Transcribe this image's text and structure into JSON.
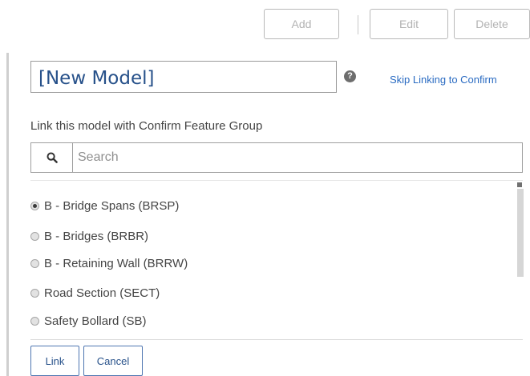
{
  "toolbar": {
    "add_label": "Add",
    "edit_label": "Edit",
    "delete_label": "Delete"
  },
  "model": {
    "name": "[New Model]",
    "help_icon": "question-circle-icon",
    "skip_link": "Skip Linking to Confirm"
  },
  "link_section": {
    "label": "Link this model with Confirm Feature Group",
    "search_icon": "search-icon",
    "search_placeholder": "Search",
    "options": [
      {
        "label": "B - Bridge Spans (BRSP)",
        "selected": true
      },
      {
        "label": "B - Bridges (BRBR)",
        "selected": false
      },
      {
        "label": "B - Retaining Wall (BRRW)",
        "selected": false
      },
      {
        "label": "Road Section (SECT)",
        "selected": false
      },
      {
        "label": "Safety Bollard (SB)",
        "selected": false
      }
    ]
  },
  "actions": {
    "link_label": "Link",
    "cancel_label": "Cancel"
  },
  "colors": {
    "accent_text": "#27518a",
    "link_blue": "#2a6bc2",
    "button_border": "#4e76b1"
  }
}
